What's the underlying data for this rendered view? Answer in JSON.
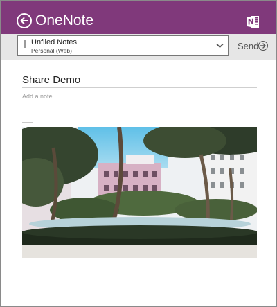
{
  "app": {
    "title": "OneNote",
    "brand_color": "#80397b",
    "icons": {
      "back": "back-arrow-icon",
      "logo": "onenote-logo-icon"
    }
  },
  "notebook_select": {
    "title": "Unfiled Notes",
    "subtitle": "Personal (Web)",
    "icon": "chevron-down-icon"
  },
  "send_button": {
    "label": "Send",
    "icon": "arrow-right-circle-icon"
  },
  "note": {
    "title": "Share Demo",
    "placeholder": "Add a note",
    "image": "photo of a tropical resort courtyard with palm trees and pool"
  }
}
